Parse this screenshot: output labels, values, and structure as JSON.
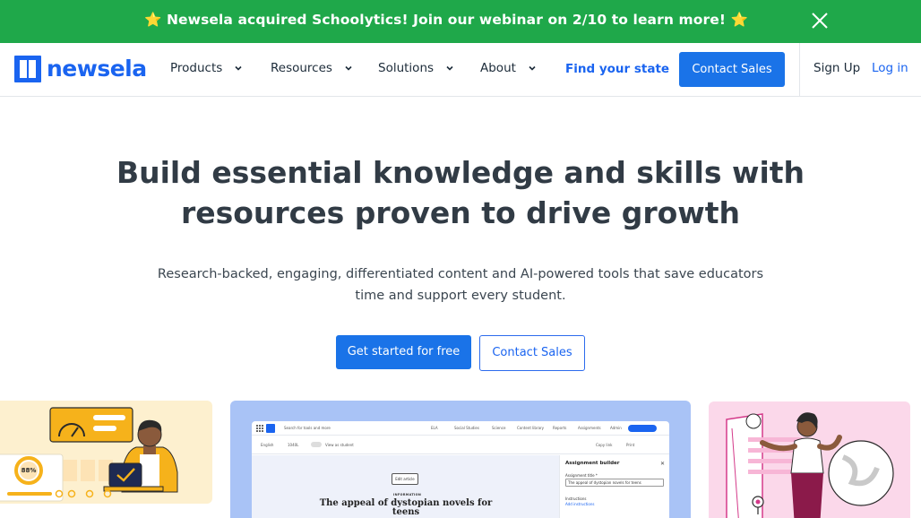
{
  "banner": {
    "text": "⭐ Newsela acquired Schoolytics! Join our webinar on 2/10 to learn more! ⭐"
  },
  "nav": {
    "logo_text": "newsela",
    "items": [
      {
        "label": "Products"
      },
      {
        "label": "Resources"
      },
      {
        "label": "Solutions"
      },
      {
        "label": "About"
      }
    ],
    "find_state": "Find your state",
    "contact_sales": "Contact Sales",
    "sign_up": "Sign Up",
    "log_in": "Log in"
  },
  "hero": {
    "title": "Build essential knowledge and skills with resources proven to drive growth",
    "subtitle": "Research-backed, engaging, differentiated content and AI-powered tools that save educators time and support every student.",
    "cta_primary": "Get started for free",
    "cta_secondary": "Contact Sales"
  },
  "cards": {
    "left": {
      "gauge_percent": "88%"
    },
    "mid": {
      "top": {
        "search": "Search for tools and more",
        "ela": "ELA",
        "social": "Social Studies",
        "science": "Science",
        "content_library": "Content library",
        "reports": "Reports",
        "assignments": "Assignments",
        "admin": "Admin"
      },
      "bar": {
        "language": "English",
        "level": "1040L",
        "view_student": "View as student",
        "copy_link": "Copy link",
        "print": "Print",
        "assign": "Assign"
      },
      "edit_article": "Edit article",
      "info_tag": "INFORMATION",
      "article_title": "The appeal of dystopian novels for teens",
      "builder": {
        "title": "Assignment builder",
        "label_title": "Assignment title *",
        "input_value": "The appeal of dystopian novels for teens",
        "label_instructions": "Instructions",
        "add_instructions": "Add instructions"
      }
    }
  },
  "colors": {
    "banner": "#1fa84a",
    "brand_blue": "#1a64f0",
    "button_blue": "#1a73e8",
    "card_yellow": "#fdf0cf",
    "card_blue": "#a9c3f6",
    "card_pink": "#fbd8ea"
  }
}
